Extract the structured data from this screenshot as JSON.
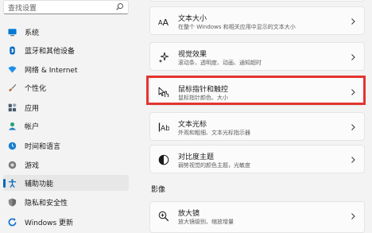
{
  "search": {
    "placeholder": "查找设置"
  },
  "sidebar": {
    "items": [
      {
        "label": "系统",
        "icon": "monitor-icon",
        "color": "#0078d4"
      },
      {
        "label": "蓝牙和其他设备",
        "icon": "bluetooth-icon",
        "color": "#0067c0"
      },
      {
        "label": "网络 & Internet",
        "icon": "wifi-icon",
        "color": "#1f8fe8"
      },
      {
        "label": "个性化",
        "icon": "brush-icon",
        "color": "#c1622f"
      },
      {
        "label": "应用",
        "icon": "apps-icon",
        "color": "#4a5a6a"
      },
      {
        "label": "帐户",
        "icon": "account-icon",
        "color": "#2aa37a"
      },
      {
        "label": "时间和语言",
        "icon": "globe-clock-icon",
        "color": "#1a80d0"
      },
      {
        "label": "游戏",
        "icon": "game-icon",
        "color": "#7a7a7a"
      },
      {
        "label": "辅助功能",
        "icon": "accessibility-icon",
        "color": "#0f6cbd",
        "selected": true
      },
      {
        "label": "隐私和安全性",
        "icon": "shield-icon",
        "color": "#6b6b6b"
      },
      {
        "label": "Windows 更新",
        "icon": "update-icon",
        "color": "#0a6ed1"
      }
    ]
  },
  "main": {
    "cards": [
      {
        "title": "文本大小",
        "desc": "在整个 Windows 和相关应用中显示的文本大小",
        "icon": "text-size-icon"
      },
      {
        "title": "视觉效果",
        "desc": "滚动条、透明度、动画、通知超时",
        "icon": "sparkle-icon"
      },
      {
        "title": "鼠标指针和触控",
        "desc": "鼠标指针颜色、大小",
        "icon": "pointer-touch-icon"
      },
      {
        "title": "文本光标",
        "desc": "外观和粗细、文本光标指示器",
        "icon": "text-cursor-icon"
      },
      {
        "title": "对比度主题",
        "desc": "弱势视觉的颜色主题，光敏度",
        "icon": "contrast-icon"
      }
    ],
    "section_label": "影像",
    "vision_cards": [
      {
        "title": "放大镜",
        "desc": "放大镜级别、缩放增量",
        "icon": "magnifier-icon"
      }
    ]
  },
  "colors": {
    "accent": "#0067c0",
    "highlight_box": "#e3342f"
  }
}
